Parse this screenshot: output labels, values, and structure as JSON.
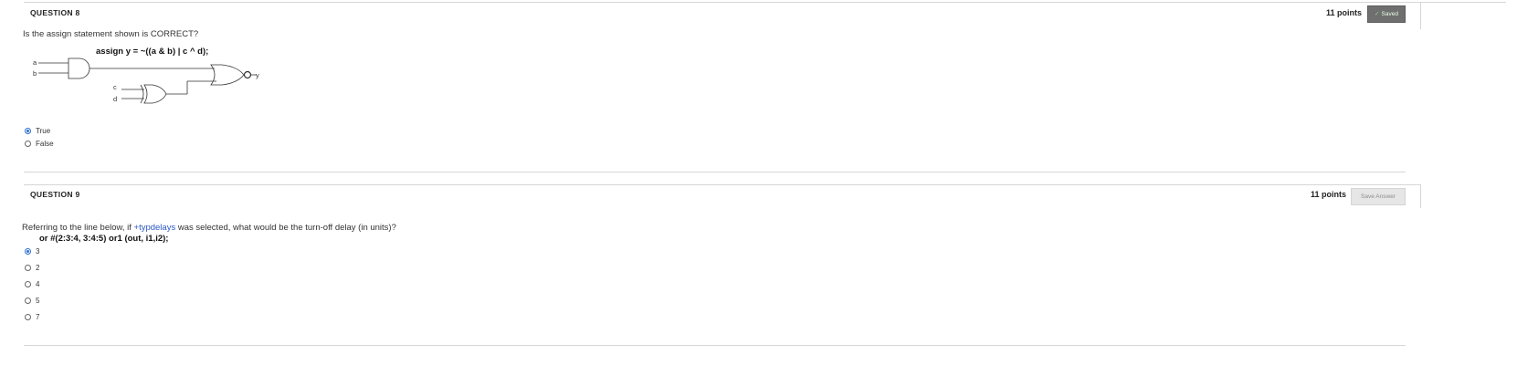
{
  "q8": {
    "header": "QUESTION 8",
    "points": "11 points",
    "saved_label": "Saved",
    "prompt": "Is the assign statement shown is CORRECT?",
    "assign_line": "assign y = ~((a & b) | c ^ d);",
    "diagram_labels": {
      "a": "a",
      "b": "b",
      "c": "c",
      "d": "d",
      "y": "y"
    },
    "options": [
      {
        "label": "True",
        "selected": true
      },
      {
        "label": "False",
        "selected": false
      }
    ]
  },
  "q9": {
    "header": "QUESTION 9",
    "points": "11 points",
    "save_answer_label": "Save Answer",
    "prompt_prefix": "Referring to the line below, if ",
    "prompt_link": "+typdelays",
    "prompt_suffix": " was selected, what would be the turn-off delay (in units)?",
    "code_line": "or  #(2:3:4, 3:4:5) or1 (out, i1,i2);",
    "options": [
      {
        "label": "3",
        "selected": true
      },
      {
        "label": "2",
        "selected": false
      },
      {
        "label": "4",
        "selected": false
      },
      {
        "label": "5",
        "selected": false
      },
      {
        "label": "7",
        "selected": false
      }
    ]
  },
  "colors": {
    "accent": "#2c6fd1",
    "link": "#2b59c3",
    "saved_bg": "#6f6f6f"
  }
}
